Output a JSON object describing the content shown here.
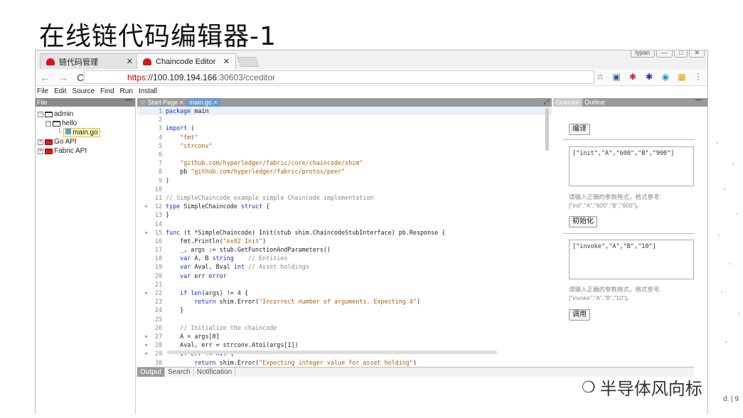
{
  "slide": {
    "title": "在线链代码编辑器-1",
    "page_number": "d. | 9",
    "watermark": "半导体风向标"
  },
  "browser": {
    "tabs": [
      {
        "label": "链代码管理"
      },
      {
        "label": "Chaincode Editor"
      }
    ],
    "window_controls": [
      "lyjiao",
      "—",
      "□",
      "✕"
    ],
    "url_scheme": "https",
    "url_host": "://100.109.194.166",
    "url_path": ":30603/cceditor"
  },
  "menu": [
    "File",
    "Edit",
    "Source",
    "Find",
    "Run",
    "Install"
  ],
  "file_pane": {
    "title": "File",
    "tree": [
      {
        "label": "admin",
        "level": 0
      },
      {
        "label": "hello",
        "level": 1
      },
      {
        "label": "main.go",
        "level": 2
      },
      {
        "label": "Go API",
        "level": 0
      },
      {
        "label": "Fabric API",
        "level": 0
      }
    ]
  },
  "editor": {
    "tabs": [
      {
        "label": "☆ Start Page ×"
      },
      {
        "label": "main.go ×"
      }
    ],
    "lines": [
      {
        "n": "1",
        "text": "package main"
      },
      {
        "n": "2",
        "text": ""
      },
      {
        "n": "3",
        "text": "import ("
      },
      {
        "n": "4",
        "text": "    \"fmt\""
      },
      {
        "n": "5",
        "text": "    \"strconv\""
      },
      {
        "n": "6",
        "text": ""
      },
      {
        "n": "7",
        "text": "    \"github.com/hyperledger/fabric/core/chaincode/shim\""
      },
      {
        "n": "8",
        "text": "    pb \"github.com/hyperledger/fabric/protos/peer\""
      },
      {
        "n": "9",
        "text": ")"
      },
      {
        "n": "10",
        "text": ""
      },
      {
        "n": "11",
        "text": "// SimpleChaincode example simple Chaincode implementation"
      },
      {
        "n": "12",
        "text": "type SimpleChaincode struct {"
      },
      {
        "n": "13",
        "text": "}"
      },
      {
        "n": "14",
        "text": ""
      },
      {
        "n": "15",
        "text": "func (t *SimpleChaincode) Init(stub shim.ChaincodeStubInterface) pb.Response {"
      },
      {
        "n": "16",
        "text": "    fmt.Println(\"ex02 Init\")"
      },
      {
        "n": "17",
        "text": "    _, args := stub.GetFunctionAndParameters()"
      },
      {
        "n": "18",
        "text": "    var A, B string    // Entities"
      },
      {
        "n": "19",
        "text": "    var Aval, Bval int // Asset holdings"
      },
      {
        "n": "20",
        "text": "    var err error"
      },
      {
        "n": "21",
        "text": ""
      },
      {
        "n": "22",
        "text": "    if len(args) != 4 {"
      },
      {
        "n": "23",
        "text": "        return shim.Error(\"Incorrect number of arguments. Expecting 4\")"
      },
      {
        "n": "24",
        "text": "    }"
      },
      {
        "n": "25",
        "text": ""
      },
      {
        "n": "26",
        "text": "    // Initialize the chaincode"
      },
      {
        "n": "27",
        "text": "    A = args[0]"
      },
      {
        "n": "28",
        "text": "    Aval, err = strconv.Atoi(args[1])"
      },
      {
        "n": "29",
        "text": "    if err != nil {"
      },
      {
        "n": "30",
        "text": "        return shim.Error(\"Expecting integer value for asset holding\")"
      }
    ]
  },
  "bottom_tabs": [
    "Output",
    "Search",
    "Notification"
  ],
  "operate_pane": {
    "tabs": [
      "Operate",
      "Outline"
    ],
    "compile_label": "编译",
    "init_args": "[\"init\",\"A\",\"600\",\"B\",\"900\"]",
    "init_hint_1": "请输入正确的参数格式，格式参考:",
    "init_hint_2": "[\"init\",\"A\",\"600\",\"B\",\"900\"]。",
    "init_label": "初始化",
    "invoke_args": "[\"invoke\",\"A\",\"B\",\"10\"]",
    "invoke_hint_1": "请输入正确的参数格式，格式参考:",
    "invoke_hint_2": "[\"invoke\",\"A\",\"B\",\"10\"]。",
    "invoke_label": "调用"
  }
}
